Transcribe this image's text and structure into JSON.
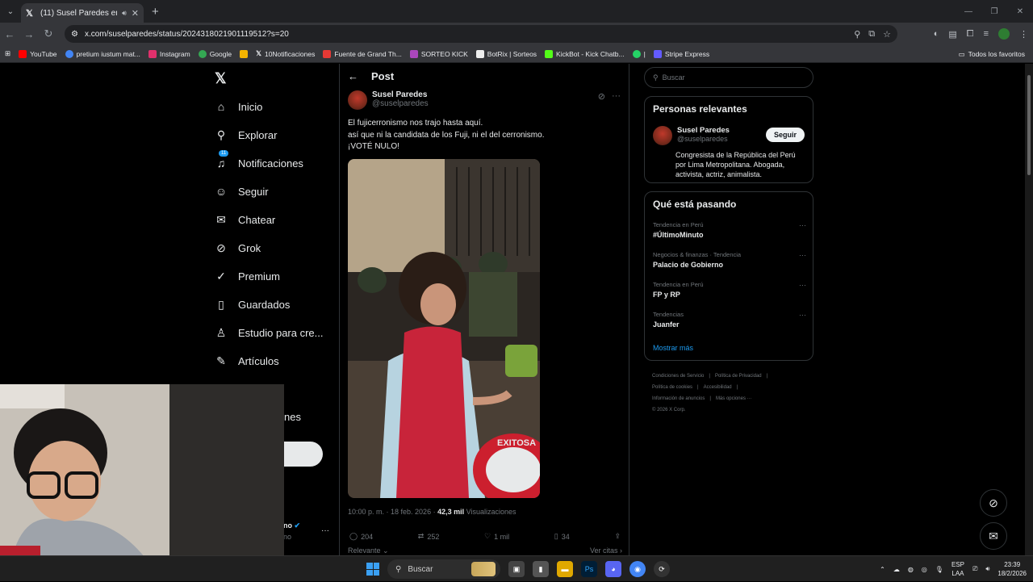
{
  "browser": {
    "tab_title": "(11) Susel Paredes en X: \"El",
    "url": "x.com/suselparedes/status/2024318021901119512?s=20",
    "bookmarks": [
      {
        "label": "YouTube",
        "color": "#ff0000"
      },
      {
        "label": "pretium iustum mat...",
        "color": "#4285f4"
      },
      {
        "label": "Instagram",
        "color": "#e1306c"
      },
      {
        "label": "Google",
        "color": "#34a853"
      },
      {
        "label": "",
        "color": "#f4b400"
      },
      {
        "label": "10Notificaciones",
        "color": "#ffffff"
      },
      {
        "label": "Fuente de Grand Th...",
        "color": "#e53935"
      },
      {
        "label": "SORTEO KICK",
        "color": "#ab47bc"
      },
      {
        "label": "BotRix | Sorteos",
        "color": "#eeeeee"
      },
      {
        "label": "KickBot - Kick Chatb...",
        "color": "#53fc18"
      },
      {
        "label": "|",
        "color": "#25d366"
      },
      {
        "label": "Stripe Express",
        "color": "#635bff"
      }
    ],
    "all_favorites": "Todos los favoritos"
  },
  "nav": {
    "items": [
      {
        "label": "Inicio",
        "icon": "home-icon",
        "glyph": "⌂"
      },
      {
        "label": "Explorar",
        "icon": "search-icon",
        "glyph": "⚲"
      },
      {
        "label": "Notificaciones",
        "icon": "bell-icon",
        "glyph": "🔔︎"
      },
      {
        "label": "Seguir",
        "icon": "person-add-icon",
        "glyph": "👤︎"
      },
      {
        "label": "Chatear",
        "icon": "mail-icon",
        "glyph": "✉"
      },
      {
        "label": "Grok",
        "icon": "grok-icon",
        "glyph": "⊘"
      },
      {
        "label": "Premium",
        "icon": "verified-icon",
        "glyph": "✓"
      },
      {
        "label": "Guardados",
        "icon": "bookmark-icon",
        "glyph": "▯"
      },
      {
        "label": "Estudio para cre...",
        "icon": "studio-icon",
        "glyph": "♙"
      },
      {
        "label": "Artículos",
        "icon": "articles-icon",
        "glyph": "✎"
      }
    ],
    "notif_badge": "11",
    "partial_more": "nes",
    "partial_user_name": "ano",
    "partial_user_handle": "ano"
  },
  "post": {
    "header": "Post",
    "author_name": "Susel Paredes",
    "author_handle": "@suselparedes",
    "text_lines": [
      "El fujicerronismo nos trajo hasta aquí.",
      "así que ni la candidata de los Fuji, ni el del cerronismo.",
      "¡VOTÉ NULO!"
    ],
    "time": "10:00 p. m. · 18 feb. 2026 ·",
    "views": "42,3 mil",
    "views_label": "Visualizaciones",
    "replies": "204",
    "reposts": "252",
    "likes": "1 mil",
    "bookmarks": "34",
    "sort": "Relevante ⌄",
    "quotes": "Ver citas ›",
    "mic_label": "EXITOSA"
  },
  "sidebar": {
    "search_placeholder": "Buscar",
    "relevant_title": "Personas relevantes",
    "relevant_name": "Susel Paredes",
    "relevant_handle": "@suselparedes",
    "follow_label": "Seguir",
    "relevant_bio": "Congresista de la República del Perú por Lima Metropolitana. Abogada, activista, actriz, animalista.",
    "trends_title": "Qué está pasando",
    "trends": [
      {
        "context": "Tendencia en Perú",
        "name": "#ÚltimoMinuto"
      },
      {
        "context": "Negocios & finanzas · Tendencia",
        "name": "Palacio de Gobierno"
      },
      {
        "context": "Tendencia en Perú",
        "name": "FP y RP"
      },
      {
        "context": "Tendencias",
        "name": "Juanfer"
      }
    ],
    "show_more": "Mostrar más",
    "footer": [
      "Condiciones de Servicio",
      "|",
      "Política de Privacidad",
      "|",
      "Política de cookies",
      "|",
      "Accesibilidad",
      "|",
      "Información de anuncios",
      "|",
      "Más opciones ···",
      "© 2026 X Corp."
    ]
  },
  "taskbar": {
    "search": "Buscar",
    "lang_1": "ESP",
    "lang_2": "LAA",
    "time": "23:39",
    "date": "18/2/2026"
  },
  "colors": {
    "accent": "#1d9bf0",
    "background": "#000000",
    "border": "#2f3336"
  }
}
